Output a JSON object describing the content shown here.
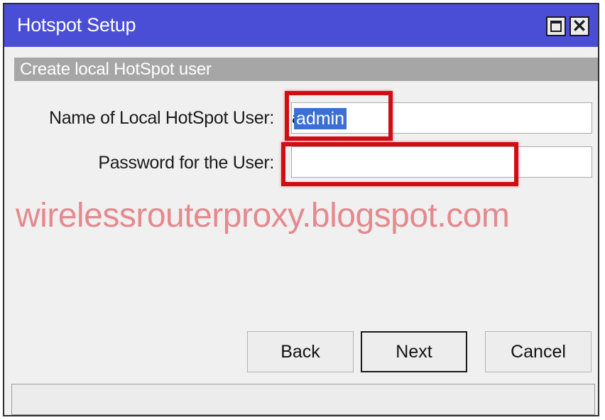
{
  "window": {
    "title": "Hotspot Setup",
    "controls": {
      "maximize_icon": "maximize-icon",
      "close_icon": "close-icon",
      "close_glyph": "✕"
    }
  },
  "section": {
    "header": "Create local HotSpot user"
  },
  "form": {
    "name_label": "Name of Local HotSpot User:",
    "name_value": "admin",
    "password_label": "Password for the User:",
    "password_value": ""
  },
  "watermark": "wirelessrouterproxy.blogspot.com",
  "buttons": {
    "back": "Back",
    "next": "Next",
    "cancel": "Cancel"
  },
  "colors": {
    "titlebar": "#4a4ed6",
    "section_header": "#a6a6a6",
    "highlight_box": "#d10d14",
    "selection": "#3b6fd6",
    "watermark": "#e5898e"
  }
}
